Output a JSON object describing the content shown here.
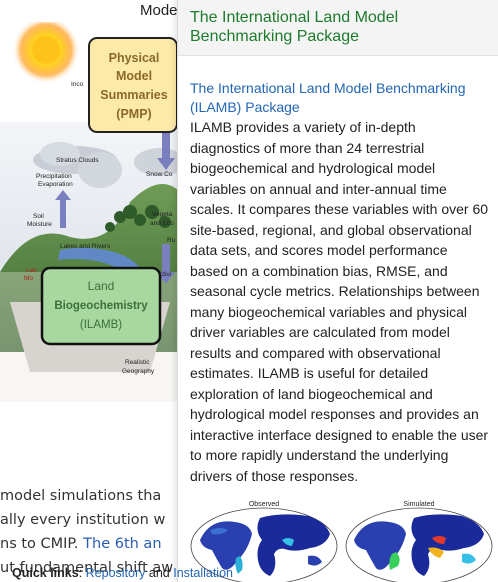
{
  "background": {
    "heading": "Mode",
    "diagram": {
      "box_pmp": [
        "Physical",
        "Model",
        "Summaries",
        "(PMP)"
      ],
      "box_ilamb": [
        "Land",
        "Biogeochemistry",
        "(ILAMB)"
      ],
      "labels": {
        "inco": "Inco",
        "stratus": "Stratus Clouds",
        "precip": "Precipitation",
        "evap": "Evaporation",
        "snow": "Snow Co",
        "soil": "Soil",
        "moisture": "Moisture",
        "vegeta": "Vegeta",
        "and_eco": "and Eco",
        "lakes": "Lakes and Rivers",
        "ru": "Ru",
        "lan": "Lan",
        "mo": "Mo",
        "ctivi": "ctivi",
        "realistic": "Realistic",
        "geography": "Geography"
      }
    },
    "text_lines": [
      {
        "text": "model simulations tha",
        "link": ""
      },
      {
        "text": "ally every institution w",
        "link": ""
      },
      {
        "text": "ns to CMIP. ",
        "link": "The 6th an"
      },
      {
        "text": "ut fundamental shift aw",
        "link": ""
      }
    ],
    "colors": {
      "pmp_fill": "#fde9a8",
      "ilamb_fill": "#a8d8a0",
      "arrow": "#7a7fbf"
    }
  },
  "popup": {
    "title": "The International Land Model Benchmarking Package",
    "heading": "The International Land Model Benchmarking (ILAMB) Package",
    "description": "ILAMB provides a variety of in-depth diagnostics of more than 24 terrestrial biogeochemical and hydrological model variables on annual and inter-annual time scales. It compares these variables with over 60 site-based, regional, and global observational data sets, and scores model performance based on a combination bias, RMSE, and seasonal cycle metrics. Relationships between many biogeochemical variables and physical driver variables are calculated from model results and compared with observational estimates. ILAMB is useful for detailed exploration of land biogeochemical and hydrological model responses and provides an interactive interface designed to enable the user to more rapidly understand the underlying drivers of those responses.",
    "maps": {
      "observed": "Observed",
      "simulated": "Simulated"
    },
    "quick_links": {
      "label": "Quick links",
      "colon": ": ",
      "repository": "Repository",
      "and": " and ",
      "installation": "Installation"
    },
    "colors": {
      "title": "#1e7a2d",
      "link": "#2366b3"
    }
  }
}
